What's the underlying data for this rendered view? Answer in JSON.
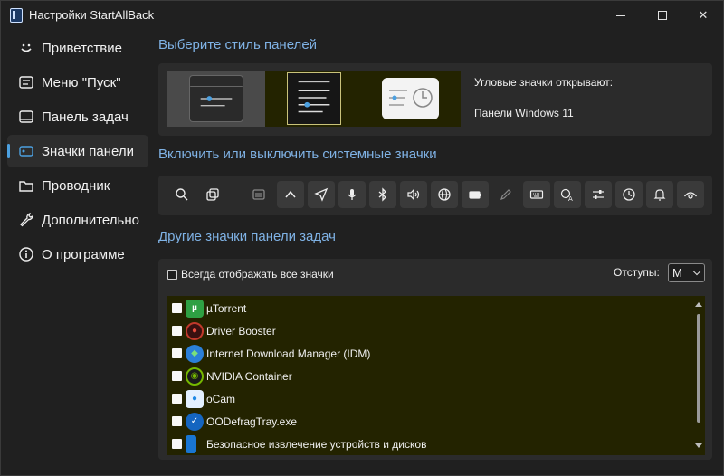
{
  "window": {
    "title": "Настройки StartAllBack"
  },
  "sidebar": {
    "items": [
      {
        "label": "Приветствие",
        "icon": "smile-icon"
      },
      {
        "label": "Меню \"Пуск\"",
        "icon": "start-menu-icon"
      },
      {
        "label": "Панель задач",
        "icon": "taskbar-icon"
      },
      {
        "label": "Значки панели",
        "icon": "tray-icons-icon",
        "active": true
      },
      {
        "label": "Проводник",
        "icon": "folder-icon"
      },
      {
        "label": "Дополнительно",
        "icon": "wrench-icon"
      },
      {
        "label": "О программе",
        "icon": "info-icon"
      }
    ]
  },
  "main": {
    "style_title": "Выберите стиль панелей",
    "corner_label": "Угловые значки открывают:",
    "corner_value": "Панели Windows 11",
    "system_icons_title": "Включить или выключить системные значки",
    "system_icons": [
      "search-icon",
      "task-view-icon",
      "widgets-icon",
      "chevron-up-icon",
      "location-icon",
      "microphone-icon",
      "bluetooth-icon",
      "volume-icon",
      "network-globe-icon",
      "battery-icon",
      "pen-icon",
      "keyboard-icon",
      "language-icon",
      "mixer-icon",
      "clock-icon",
      "bell-icon",
      "eye-icon"
    ],
    "other_title": "Другие значки панели задач",
    "always_show_label": "Всегда отображать все значки",
    "padding_label": "Отступы:",
    "padding_value": "M",
    "apps": [
      {
        "name": "µTorrent",
        "color": "#2ea043"
      },
      {
        "name": "Driver Booster",
        "color": "#c0392b"
      },
      {
        "name": "Internet Download Manager (IDM)",
        "color": "#2b7fd8"
      },
      {
        "name": "NVIDIA Container",
        "color": "#76b900"
      },
      {
        "name": "oCam",
        "color": "#1e88e5"
      },
      {
        "name": "OODefragTray.exe",
        "color": "#1565c0"
      },
      {
        "name": "Безопасное извлечение устройств и дисков",
        "color": "#1976d2"
      }
    ]
  },
  "colors": {
    "accent": "#4ca0e0",
    "section_title": "#7fb2e5",
    "selected_bg": "#232300"
  }
}
